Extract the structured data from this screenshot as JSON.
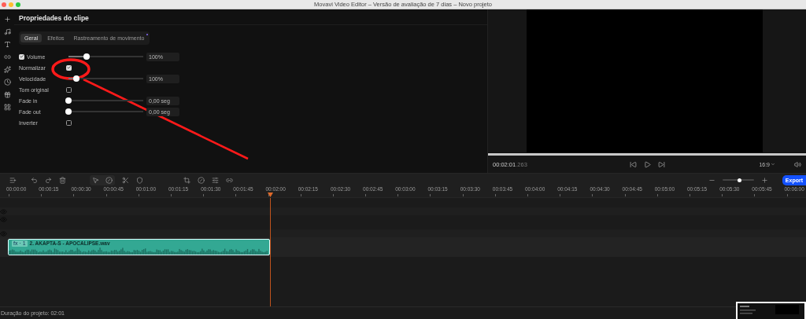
{
  "window": {
    "title": "Movavi Video Editor – Versão de avaliação de 7 dias – Novo projeto"
  },
  "panel": {
    "title": "Propriedades do clipe"
  },
  "tabs": [
    {
      "label": "Geral",
      "selected": true,
      "badge": false
    },
    {
      "label": "Efeitos",
      "selected": false,
      "badge": false
    },
    {
      "label": "Rastreamento de movimento",
      "selected": false,
      "badge": true
    }
  ],
  "properties": [
    {
      "kind": "slider",
      "label": "Volume",
      "checked": true,
      "level": 0.24,
      "value": "100%"
    },
    {
      "kind": "checkbox",
      "label": "Normalizar",
      "checked": true
    },
    {
      "kind": "slider",
      "label": "Velocidade",
      "level": 0.1,
      "value": "100%"
    },
    {
      "kind": "checkbox",
      "label": "Tom original",
      "checked": false
    },
    {
      "kind": "slider",
      "label": "Fade in",
      "level": 0,
      "value": "0,00 seg"
    },
    {
      "kind": "slider",
      "label": "Fade out",
      "level": 0,
      "value": "0,00 seg"
    },
    {
      "kind": "checkbox",
      "label": "Inverter",
      "checked": false
    }
  ],
  "preview": {
    "time": "00:02:01",
    "time_ms": ".263",
    "aspect": "16:9"
  },
  "timeline": {
    "zoom": {
      "level": 0.55
    },
    "export": "Export",
    "ruler": [
      "00:00:00",
      "00:00:15",
      "00:00:30",
      "00:00:45",
      "00:01:00",
      "00:01:15",
      "00:01:30",
      "00:01:45",
      "00:02:00",
      "00:02:15",
      "00:02:30",
      "00:02:45",
      "00:03:00",
      "00:03:15",
      "00:03:30",
      "00:03:45",
      "00:04:00",
      "00:04:15",
      "00:04:30",
      "00:04:45",
      "00:05:00",
      "00:05:15",
      "00:05:30",
      "00:05:45",
      "00:06:00"
    ],
    "clip": {
      "badge": "fx · 1",
      "name": "2. AKAPTA-S - APOCALIPSE.wav"
    }
  },
  "status_bar": "Duração do projeto: 02:01"
}
